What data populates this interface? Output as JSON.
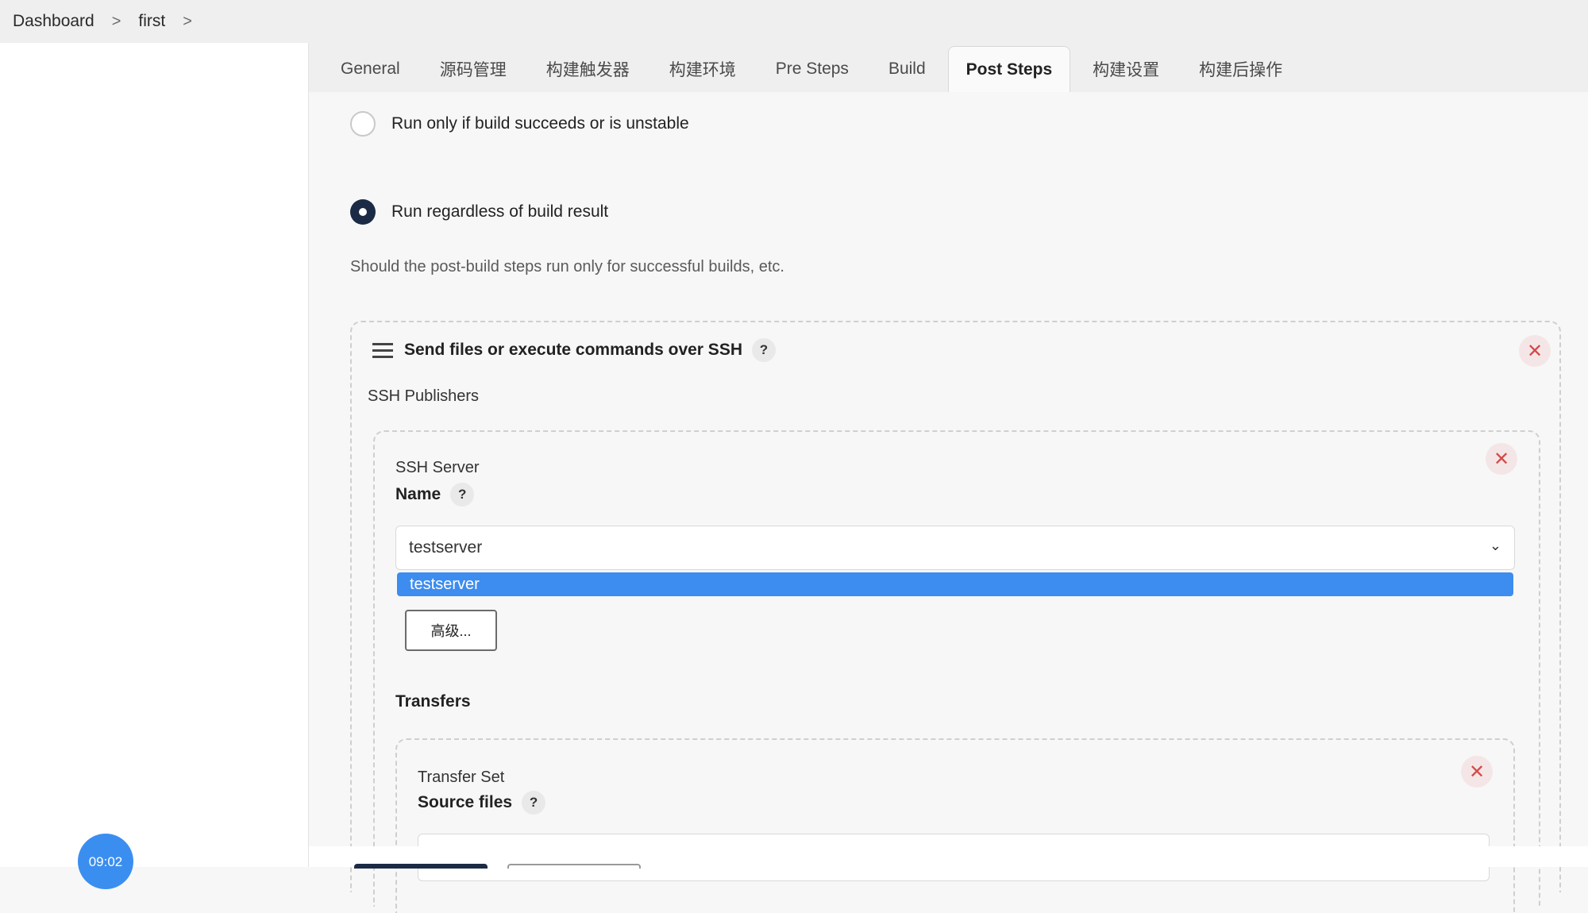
{
  "breadcrumb": {
    "items": [
      "Dashboard",
      "first"
    ],
    "separator": ">"
  },
  "tabs": [
    "General",
    "源码管理",
    "构建触发器",
    "构建环境",
    "Pre Steps",
    "Build",
    "Post Steps",
    "构建设置",
    "构建后操作"
  ],
  "active_tab": "Post Steps",
  "post_steps": {
    "options": [
      {
        "label": "Run only if build succeeds or is unstable",
        "checked": false
      },
      {
        "label": "Run regardless of build result",
        "checked": true
      }
    ],
    "hint": "Should the post-build steps run only for successful builds, etc."
  },
  "ssh_step": {
    "title": "Send files or execute commands over SSH",
    "help": "?",
    "publishers_label": "SSH Publishers",
    "server": {
      "section_label": "SSH Server",
      "name_label": "Name",
      "help": "?",
      "selected": "testserver",
      "options": [
        "testserver"
      ],
      "advanced_button": "高级..."
    },
    "transfers_label": "Transfers",
    "transfer_set": {
      "section_label": "Transfer Set",
      "source_label": "Source files",
      "help": "?",
      "source_value": ""
    },
    "close_symbol": "✕"
  },
  "clock": {
    "time": "09:02"
  },
  "colors": {
    "accent_blue": "#3d8cf0",
    "radio_checked": "#1b2b45",
    "close_red": "#d54a4a"
  },
  "icons": [
    "hamburger-icon",
    "chevron-down-icon",
    "close-icon",
    "help-icon",
    "chevron-right-icon"
  ]
}
